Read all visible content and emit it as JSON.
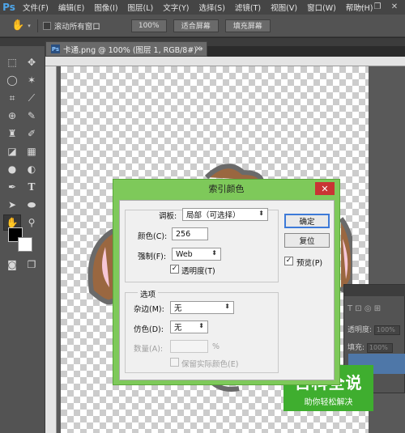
{
  "app": {
    "logo": "Ps"
  },
  "menu": [
    "文件(F)",
    "编辑(E)",
    "图像(I)",
    "图层(L)",
    "文字(Y)",
    "选择(S)",
    "滤镜(T)",
    "视图(V)",
    "窗口(W)",
    "帮助(H)"
  ],
  "window_controls": {
    "minimize": "—",
    "restore": "❐",
    "close": "✕"
  },
  "options_bar": {
    "scroll_all_label": "滚动所有窗口",
    "zoom_100": "100%",
    "fit_screen": "适合屏幕",
    "fill_screen": "填充屏幕"
  },
  "document": {
    "tab_title": "卡通.png @ 100% (图层 1, RGB/8#) *",
    "tab_close": "×"
  },
  "dialog": {
    "title": "索引颜色",
    "close": "✕",
    "palette_label": "调板:",
    "palette_value": "局部（可选择）",
    "colors_label": "颜色(C):",
    "colors_value": "256",
    "forced_label": "强制(F):",
    "forced_value": "Web",
    "transparency_label": "透明度(T)",
    "transparency_checked": true,
    "options_title": "选项",
    "matte_label": "杂边(M):",
    "matte_value": "无",
    "dither_label": "仿色(D):",
    "dither_value": "无",
    "amount_label": "数量(A):",
    "amount_unit": "%",
    "preserve_label": "保留实际颜色(E)",
    "ok": "确定",
    "reset": "复位",
    "preview_label": "预览(P)",
    "preview_checked": true
  },
  "side_panel": {
    "opacity_label": "透明度:",
    "opacity_value": "100%",
    "fill_label": "填充:",
    "fill_value": "100%"
  },
  "watermark": {
    "title": "百科全说",
    "subtitle": "助你轻松解决"
  },
  "colors": {
    "accent": "#7ec95a",
    "close": "#c93434",
    "watermark": "#3fae2f",
    "ps_blue": "#4ea6ea"
  }
}
